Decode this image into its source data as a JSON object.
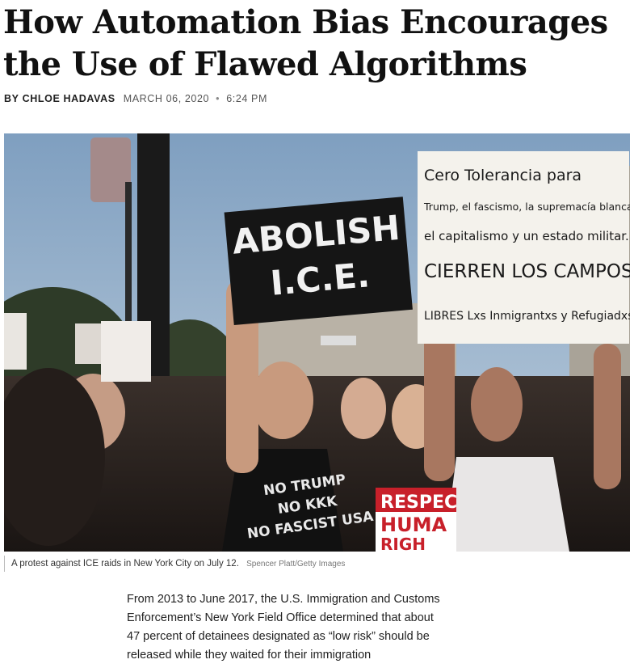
{
  "article": {
    "headline_line1": "How Automation Bias Encourages",
    "headline_line2": "the Use of Flawed Algorithms",
    "byline_prefix": "BY",
    "author": "CHLOE HADAVAS",
    "date": "MARCH 06, 2020",
    "separator": "•",
    "time": "6:24 PM"
  },
  "photo": {
    "signs": {
      "abolish_line1": "ABOLISH",
      "abolish_line2": "I.C.E.",
      "spanish_line1": "Cero Tolerancia para",
      "spanish_line2": "Trump, el fascismo, la supremacía blanca,",
      "spanish_line3": "el capitalismo y un estado militar.",
      "spanish_line4": "CIERREN LOS CAMPOS",
      "spanish_line5": "LIBRES Lxs Inmigrantxs y Refugiadxs",
      "shirt_line1": "NO TRUMP",
      "shirt_line2": "NO KKK",
      "shirt_line3": "NO FASCIST USA",
      "respect_line1": "RESPEC",
      "respect_line2": "HUMA",
      "respect_line3": "RIGH"
    },
    "colors": {
      "sky": "#9fb8d0",
      "crowd": "#2b2522",
      "sign_black": "#151515",
      "sign_white": "#f4f2ec",
      "respect_red": "#c8202a"
    }
  },
  "caption": {
    "text": "A protest against ICE raids in New York City on July 12.",
    "credit": "Spencer Platt/Getty Images"
  },
  "body": {
    "paragraph1": "From 2013 to June 2017, the U.S. Immigration and Customs Enforcement’s New York Field Office determined that about 47 percent of detainees designated as “low risk” should be released while they waited for their immigration"
  }
}
